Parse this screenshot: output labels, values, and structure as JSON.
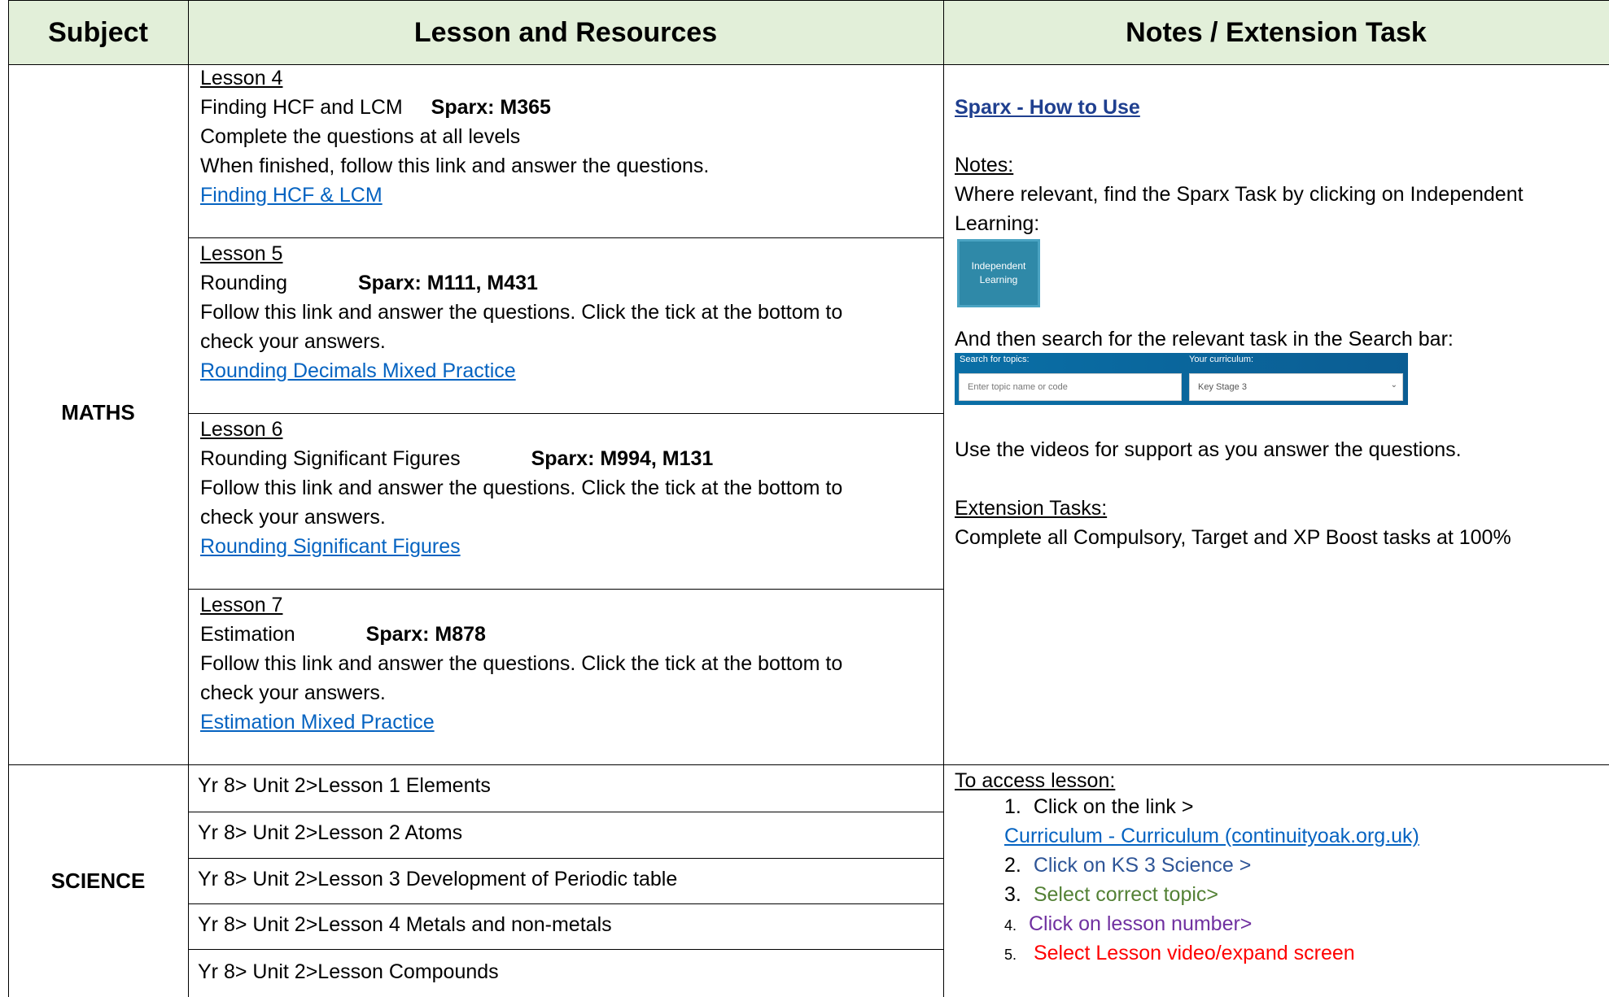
{
  "headers": {
    "subject": "Subject",
    "lesson": "Lesson and Resources",
    "notes": "Notes / Extension Task"
  },
  "maths": {
    "subject": "MATHS",
    "lessons": [
      {
        "title": "Lesson 4",
        "topic": "Finding HCF and LCM",
        "sparx": "Sparx: M365",
        "lines": [
          "Complete the questions at all levels",
          "When finished, follow this link and answer the questions."
        ],
        "link": "Finding HCF & LCM"
      },
      {
        "title": "Lesson 5",
        "topic": "Rounding",
        "sparx": "Sparx: M111, M431",
        "lines": [
          "Follow this link and answer the questions. Click the tick at the bottom to",
          "check your answers."
        ],
        "link": "Rounding Decimals Mixed Practice"
      },
      {
        "title": "Lesson 6",
        "topic": "Rounding Significant Figures",
        "sparx": "Sparx: M994, M131",
        "lines": [
          "Follow this link and answer the questions. Click the tick at the bottom to",
          "check your answers."
        ],
        "link": "Rounding Significant Figures"
      },
      {
        "title": "Lesson 7",
        "topic": "Estimation",
        "sparx": "Sparx: M878",
        "lines": [
          "Follow this link and answer the questions. Click the tick at the bottom to",
          "check your answers."
        ],
        "link": "Estimation Mixed Practice"
      }
    ],
    "notes": {
      "how_to_link": "Sparx - How to Use",
      "notes_heading": "Notes:",
      "notes_text_1": "Where relevant, find the Sparx Task by clicking on Independent",
      "notes_text_2": "Learning:",
      "il_button_line1": "Independent",
      "il_button_line2": "Learning",
      "search_text": "And then search for the relevant task in the Search bar:",
      "search_label": "Search for topics:",
      "search_placeholder": "Enter topic name or code",
      "curriculum_label": "Your curriculum:",
      "curriculum_value": "Key Stage 3",
      "videos_text": "Use the videos for support as you answer the questions.",
      "extension_heading": "Extension Tasks:",
      "extension_text": "Complete all Compulsory, Target and XP Boost tasks at 100%"
    }
  },
  "science": {
    "subject": "SCIENCE",
    "rows": [
      "Yr 8> Unit 2>Lesson 1 Elements",
      "Yr 8> Unit 2>Lesson 2 Atoms",
      "Yr 8> Unit 2>Lesson 3 Development of Periodic table",
      "Yr 8> Unit 2>Lesson 4 Metals and non-metals",
      "Yr 8> Unit 2>Lesson Compounds"
    ],
    "access": {
      "heading": "To access lesson:",
      "step1_num": "1.",
      "step1": "Click on the link >",
      "link": "Curriculum - Curriculum (continuityoak.org.uk)",
      "step2_num": "2.",
      "step2": "Click on KS 3 Science >",
      "step3_num": "3.",
      "step3": "Select correct topic>",
      "step4_num": "4.",
      "step4": "Click on lesson number>",
      "step5_num": "5.",
      "step5": "Select Lesson video/expand screen"
    },
    "step_colors": {
      "step2": "#2e5597",
      "step3": "#538135",
      "step4": "#7030a0",
      "step5": "#ff0000"
    }
  }
}
